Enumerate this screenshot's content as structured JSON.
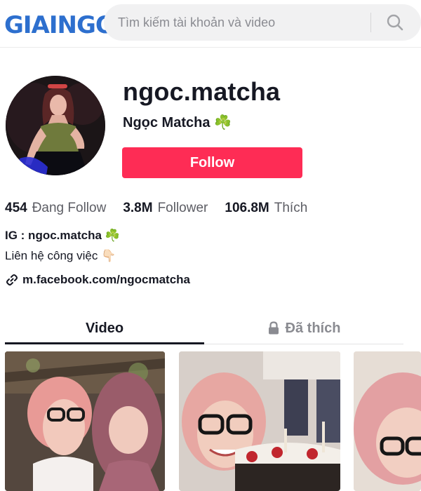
{
  "header": {
    "logo_text_a": "GIAI",
    "logo_text_b": "NGO",
    "search_placeholder": "Tìm kiếm tài khoản và video",
    "search_icon": "search-icon"
  },
  "profile": {
    "username": "ngoc.matcha",
    "nickname": "Ngọc Matcha ☘️",
    "follow_label": "Follow"
  },
  "stats": {
    "following_count": "454",
    "following_label": "Đang Follow",
    "followers_count": "3.8M",
    "followers_label": "Follower",
    "likes_count": "106.8M",
    "likes_label": "Thích"
  },
  "bio": {
    "line1": "IG : ngoc.matcha ☘️",
    "line2": "Liên hệ công việc 👇🏻",
    "link": "m.facebook.com/ngocmatcha"
  },
  "tabs": {
    "videos": "Video",
    "liked": "Đã thích"
  },
  "colors": {
    "accent": "#fe2c55",
    "logo": "#2d6fce"
  }
}
